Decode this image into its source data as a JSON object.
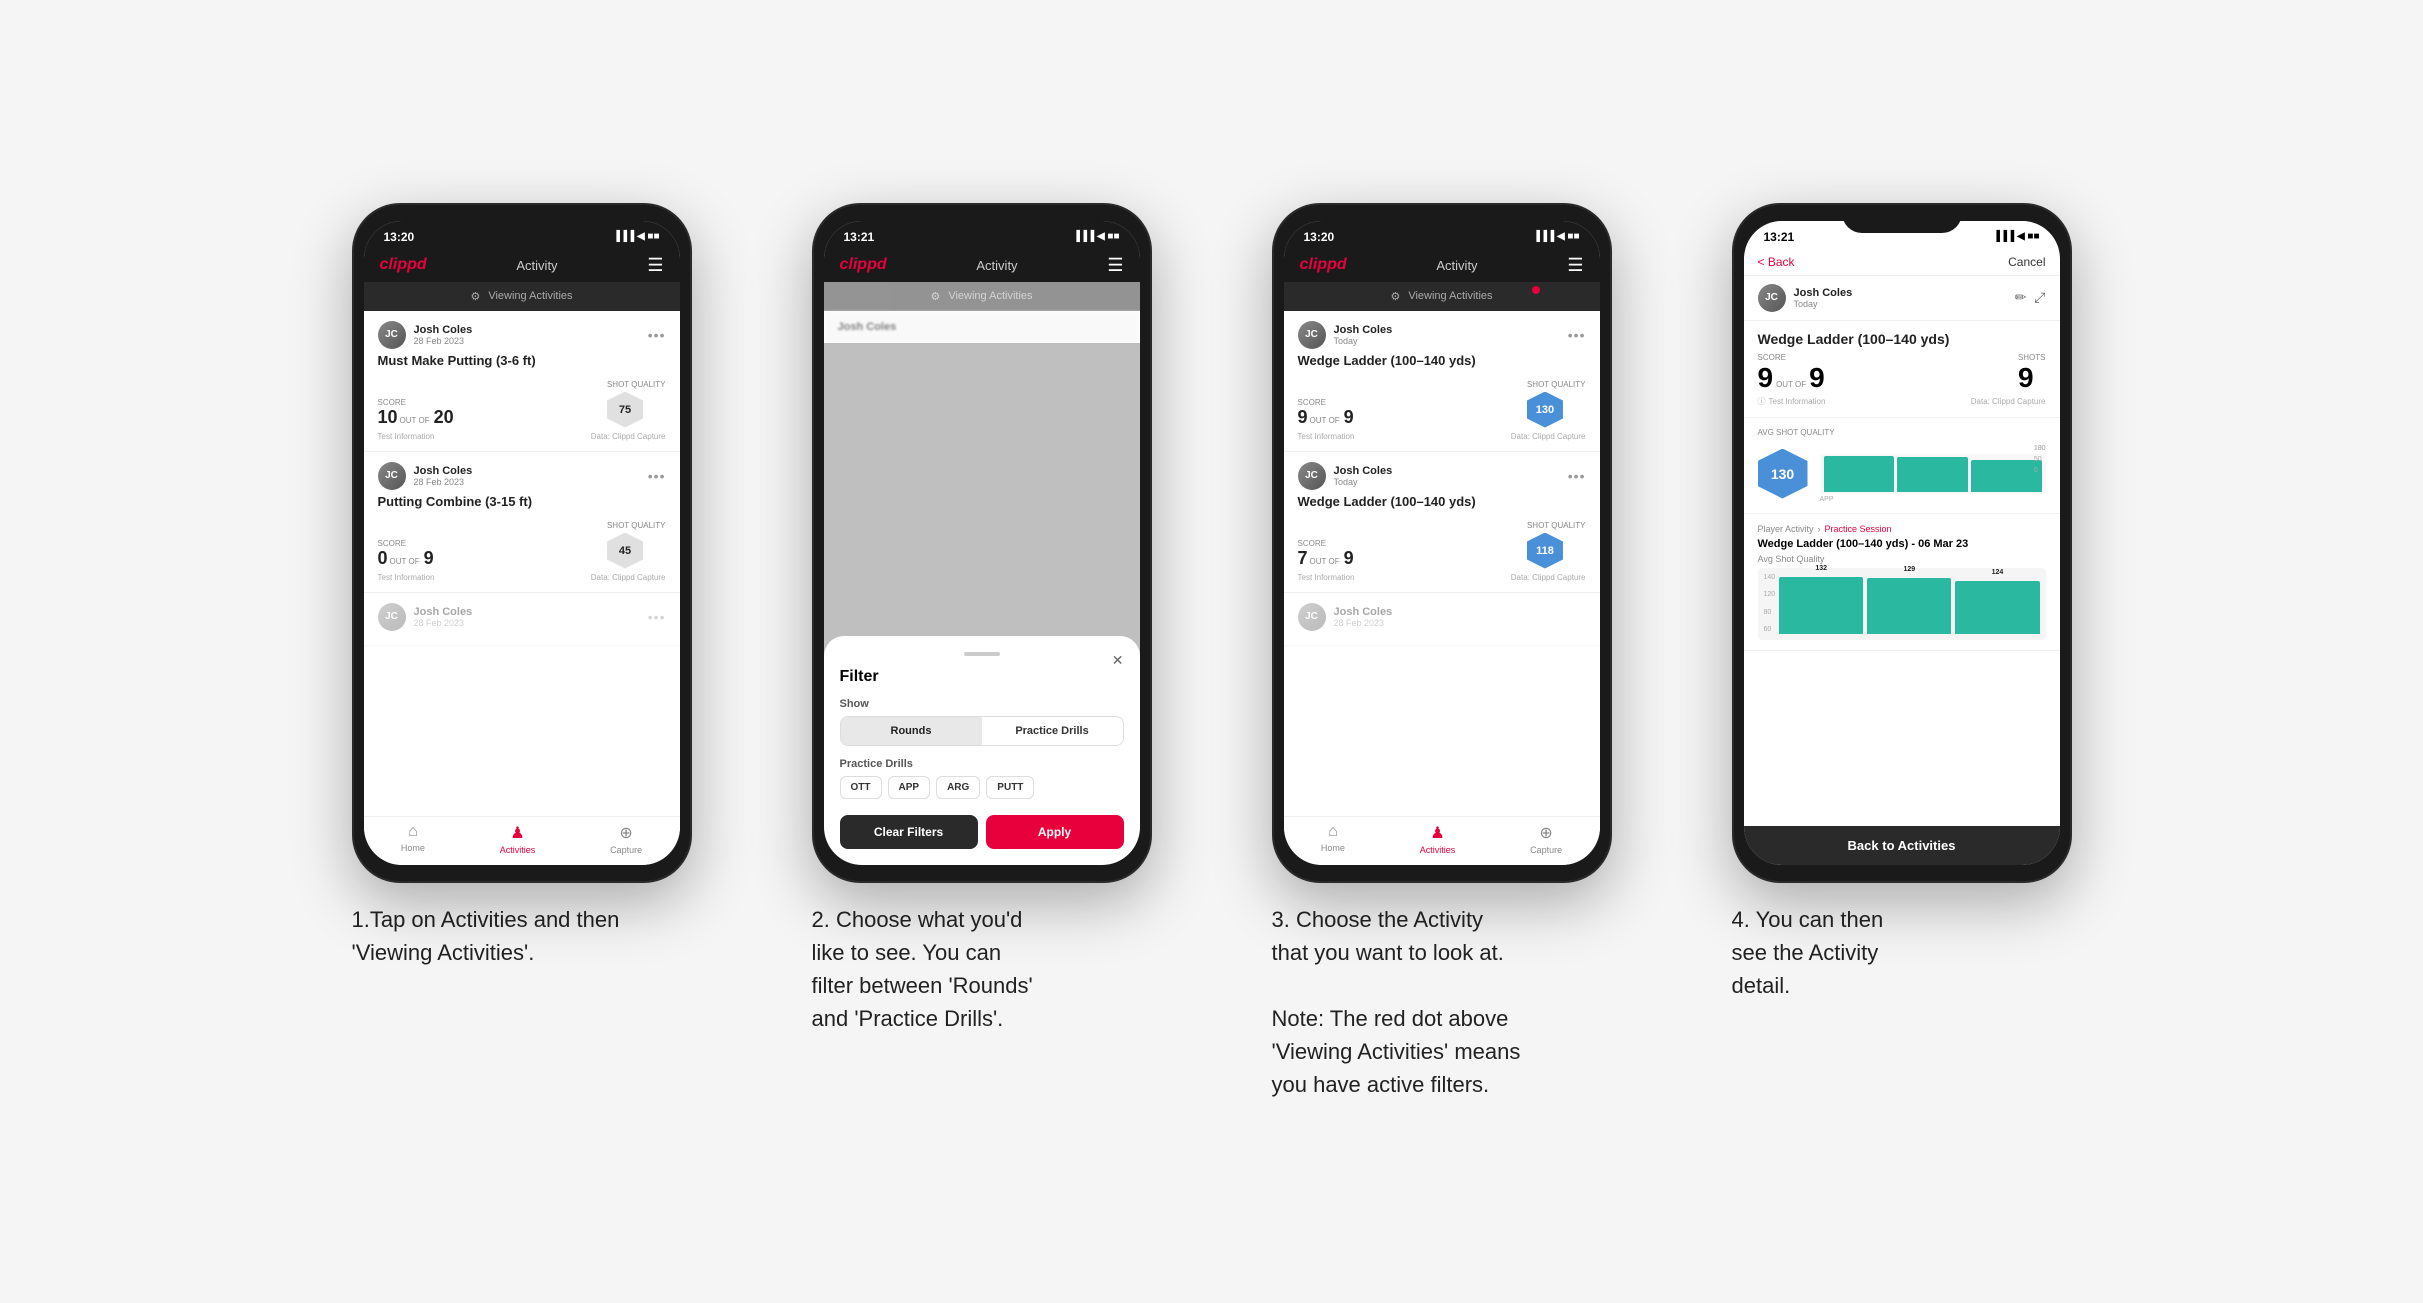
{
  "phones": [
    {
      "id": "phone1",
      "status_time": "13:20",
      "nav_logo": "clippd",
      "nav_title": "Activity",
      "banner_text": "Viewing Activities",
      "has_red_dot": false,
      "cards": [
        {
          "user_name": "Josh Coles",
          "user_date": "28 Feb 2023",
          "activity_title": "Must Make Putting (3-6 ft)",
          "score_label": "Score",
          "shots_label": "Shots",
          "quality_label": "Shot Quality",
          "score": "10",
          "out_of": "OUT OF",
          "shots": "20",
          "quality": "75",
          "quality_style": "gray",
          "footer_left": "Test Information",
          "footer_right": "Data: Clippd Capture"
        },
        {
          "user_name": "Josh Coles",
          "user_date": "28 Feb 2023",
          "activity_title": "Putting Combine (3-15 ft)",
          "score_label": "Score",
          "shots_label": "Shots",
          "quality_label": "Shot Quality",
          "score": "0",
          "out_of": "OUT OF",
          "shots": "9",
          "quality": "45",
          "quality_style": "gray",
          "footer_left": "Test Information",
          "footer_right": "Data: Clippd Capture"
        },
        {
          "user_name": "Josh Coles",
          "user_date": "28 Feb 2023",
          "activity_title": "",
          "partial": true
        }
      ]
    },
    {
      "id": "phone2",
      "status_time": "13:21",
      "nav_logo": "clippd",
      "nav_title": "Activity",
      "banner_text": "Viewing Activities",
      "filter_title": "Filter",
      "show_label": "Show",
      "toggle_rounds": "Rounds",
      "toggle_drills": "Practice Drills",
      "drills_label": "Practice Drills",
      "drill_tags": [
        "OTT",
        "APP",
        "ARG",
        "PUTT"
      ],
      "btn_clear": "Clear Filters",
      "btn_apply": "Apply"
    },
    {
      "id": "phone3",
      "status_time": "13:20",
      "nav_logo": "clippd",
      "nav_title": "Activity",
      "banner_text": "Viewing Activities",
      "has_red_dot": true,
      "cards": [
        {
          "user_name": "Josh Coles",
          "user_date": "Today",
          "activity_title": "Wedge Ladder (100–140 yds)",
          "score_label": "Score",
          "shots_label": "Shots",
          "quality_label": "Shot Quality",
          "score": "9",
          "out_of": "OUT OF",
          "shots": "9",
          "quality": "130",
          "quality_style": "blue",
          "footer_left": "Test Information",
          "footer_right": "Data: Clippd Capture"
        },
        {
          "user_name": "Josh Coles",
          "user_date": "Today",
          "activity_title": "Wedge Ladder (100–140 yds)",
          "score_label": "Score",
          "shots_label": "Shots",
          "quality_label": "Shot Quality",
          "score": "7",
          "out_of": "OUT OF",
          "shots": "9",
          "quality": "118",
          "quality_style": "blue",
          "footer_left": "Test Information",
          "footer_right": "Data: Clippd Capture"
        },
        {
          "user_name": "Josh Coles",
          "user_date": "28 Feb 2023",
          "activity_title": "",
          "partial": true
        }
      ]
    },
    {
      "id": "phone4",
      "status_time": "13:21",
      "back_label": "< Back",
      "cancel_label": "Cancel",
      "user_name": "Josh Coles",
      "user_date": "Today",
      "detail_title": "Wedge Ladder (100–140 yds)",
      "score_col": "Score",
      "shots_col": "Shots",
      "score_value": "9",
      "out_of": "OUT OF",
      "shots_value": "9",
      "avg_quality_label": "Avg Shot Quality",
      "quality_value": "130",
      "chart_bars": [
        132,
        129,
        124
      ],
      "chart_y_labels": [
        "140",
        "100",
        "50",
        "0"
      ],
      "chart_x_label": "APP",
      "player_activity_label": "Player Activity",
      "practice_session_label": "Practice Session",
      "session_title": "Wedge Ladder (100–140 yds) - 06 Mar 23",
      "session_sub": "Avg Shot Quality",
      "back_activities_btn": "Back to Activities"
    }
  ],
  "captions": [
    "1.Tap on Activities and\nthen 'Viewing Activities'.",
    "2. Choose what you'd\nlike to see. You can\nfilter between 'Rounds'\nand 'Practice Drills'.",
    "3. Choose the Activity\nthat you want to look at.\n\nNote: The red dot above\n'Viewing Activities' means\nyou have active filters.",
    "4. You can then\nsee the Activity\ndetail."
  ]
}
